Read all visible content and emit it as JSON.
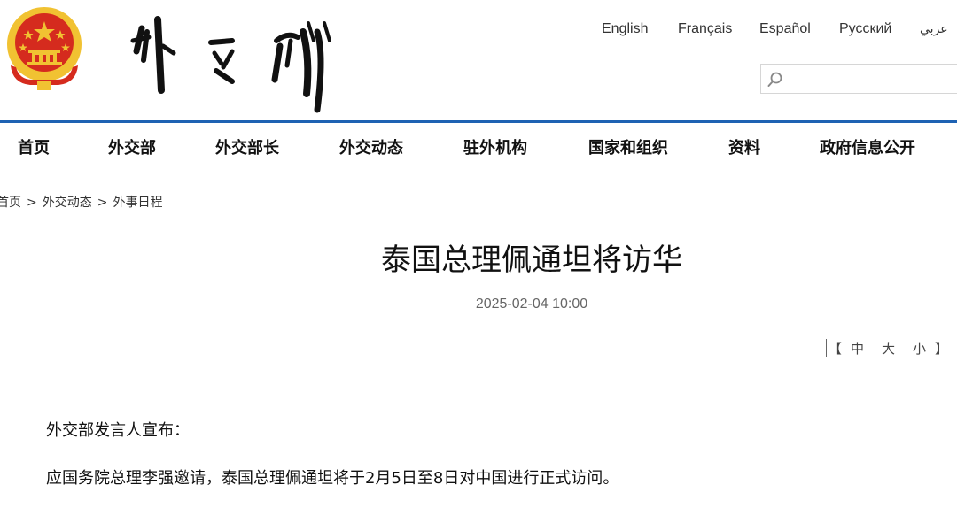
{
  "header": {
    "languages": [
      "English",
      "Français",
      "Español",
      "Русский",
      "عربي"
    ],
    "search": {
      "value": "",
      "placeholder": ""
    }
  },
  "nav": {
    "items": [
      "首页",
      "外交部",
      "外交部长",
      "外交动态",
      "驻外机构",
      "国家和组织",
      "资料",
      "政府信息公开"
    ]
  },
  "breadcrumb": {
    "items": [
      "首页",
      "外交动态",
      "外事日程"
    ],
    "separator": ">"
  },
  "article": {
    "title": "泰国总理佩通坦将访华",
    "date": "2025-02-04 10:00",
    "font_size_controls": {
      "open": "【",
      "options": [
        "中",
        "大",
        "小"
      ],
      "close": "】"
    },
    "paragraphs": [
      "外交部发言人宣布：",
      "应国务院总理李强邀请，泰国总理佩通坦将于2月5日至8日对中国进行正式访问。"
    ]
  },
  "colors": {
    "accent": "#1e62b3",
    "emblem_red": "#d52b1e",
    "emblem_gold": "#f1c232"
  }
}
